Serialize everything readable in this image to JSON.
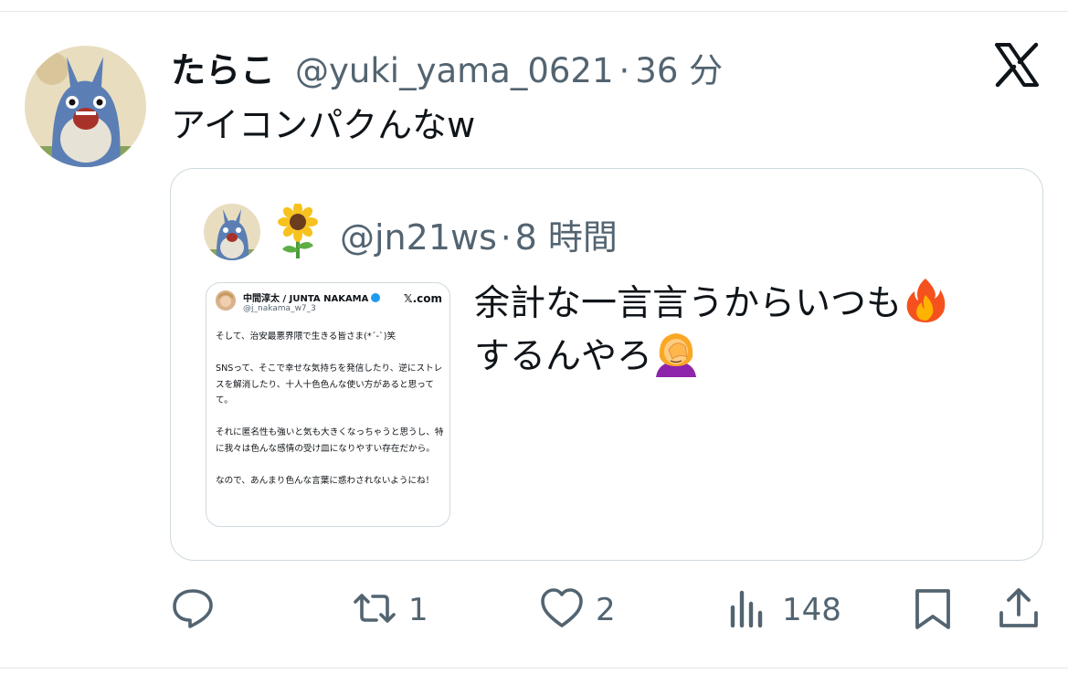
{
  "tweet": {
    "display_name": "たらこ",
    "handle": "@yuki_yama_0621",
    "separator": "·",
    "time": "36 分",
    "text": "アイコンパクんなw",
    "avatar_icon": "totoro-avatar-icon",
    "brand_icon": "x-logo-icon"
  },
  "quote": {
    "name_emoji": "sunflower-emoji",
    "handle": "@jn21ws",
    "separator": "·",
    "time": "8 時間",
    "text_line1": "余計な一言言うからいつも",
    "text_line2": "するんやろ",
    "line1_emoji": "fire-emoji",
    "line2_emoji": "facepalm-emoji",
    "image": {
      "name": "中間淳太 / JUNTA NAKAMA",
      "handle": "@j_nakama_w7_3",
      "site": "𝕏.com",
      "paragraphs": [
        "そして、治安最悪界隈で生きる皆さま(*´-`)笑",
        "SNSって、そこで幸せな気持ちを発信したり、逆にストレスを解消したり、十人十色色んな使い方があると思ってて。",
        "それに匿名性も強いと気も大きくなっちゃうと思うし、特に我々は色んな感情の受け皿になりやすい存在だから。",
        "なので、あんまり色んな言葉に惑わされないようにね！"
      ]
    }
  },
  "actions": {
    "reply": {
      "icon": "reply-icon",
      "count": ""
    },
    "retweet": {
      "icon": "retweet-icon",
      "count": "1"
    },
    "like": {
      "icon": "heart-icon",
      "count": "2"
    },
    "views": {
      "icon": "views-icon",
      "count": "148"
    },
    "bookmark": {
      "icon": "bookmark-icon"
    },
    "share": {
      "icon": "share-icon"
    }
  },
  "colors": {
    "text": "#0f1419",
    "secondary": "#536471",
    "border": "#cfd9de",
    "avatar_blue": "#5b7fb5",
    "avatar_bg": "#e9ddc0"
  }
}
